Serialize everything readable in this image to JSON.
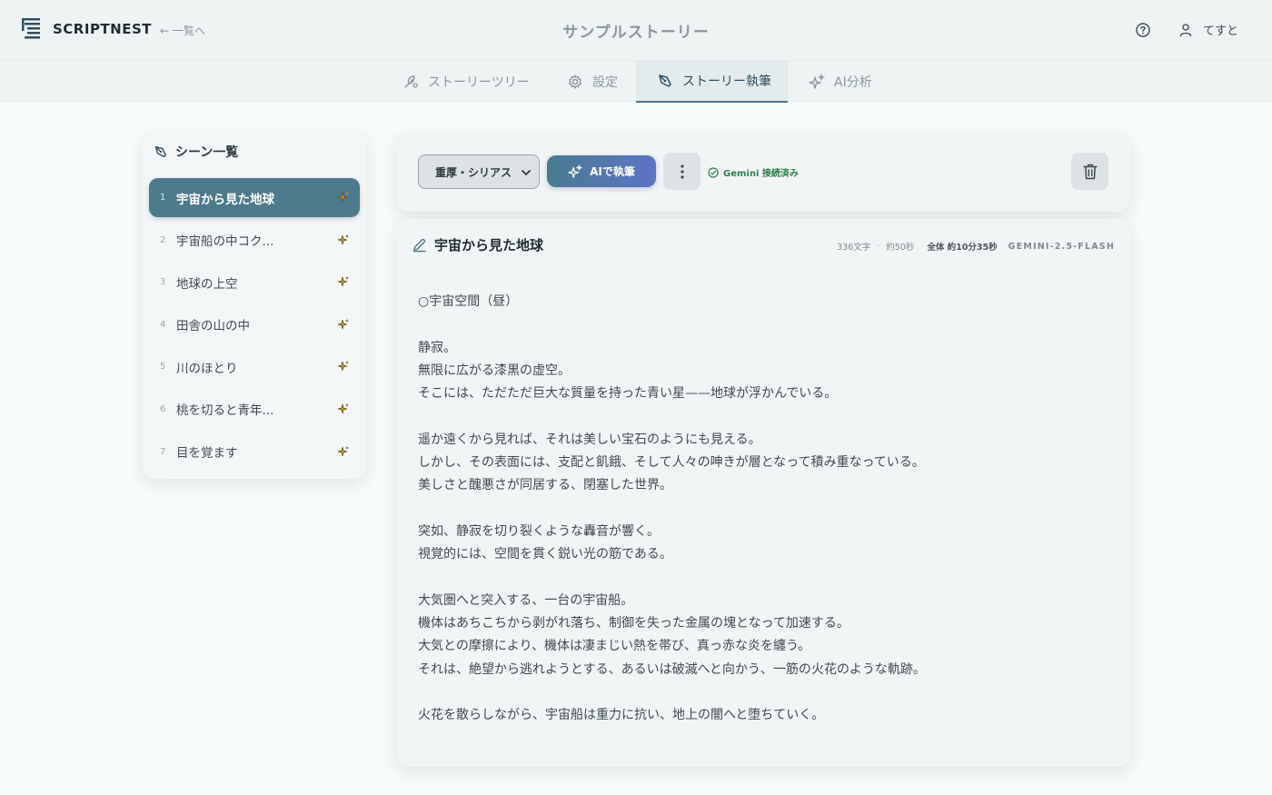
{
  "header": {
    "app_name": "SCRIPTNEST",
    "back_label": "← 一覧へ",
    "page_title": "サンプルストーリー",
    "user_name": "てすと"
  },
  "tabs": [
    {
      "label": "ストーリーツリー",
      "icon": "tree-icon"
    },
    {
      "label": "設定",
      "icon": "gear-icon"
    },
    {
      "label": "ストーリー執筆",
      "icon": "pen-nib-icon",
      "active": true
    },
    {
      "label": "AI分析",
      "icon": "sparkles-icon"
    }
  ],
  "sidebar": {
    "title": "シーン一覧",
    "scenes": [
      {
        "num": "1",
        "title": "宇宙から見た地球",
        "active": true
      },
      {
        "num": "2",
        "title": "宇宙船の中コク..."
      },
      {
        "num": "3",
        "title": "地球の上空"
      },
      {
        "num": "4",
        "title": "田舎の山の中"
      },
      {
        "num": "5",
        "title": "川のほとり"
      },
      {
        "num": "6",
        "title": "桃を切ると青年..."
      },
      {
        "num": "7",
        "title": "目を覚ます"
      }
    ]
  },
  "toolbar": {
    "tone_selected": "重厚・シリアス",
    "ai_write_label": "AIで執筆",
    "status_label": "Gemini 接続済み"
  },
  "editor": {
    "scene_title": "宇宙から見た地球",
    "char_count": "336文字",
    "duration": "約50秒",
    "total_duration": "全体 約10分35秒",
    "model": "GEMINI-2.5-FLASH",
    "body": "○宇宙空間（昼）\n\n静寂。\n無限に広がる漆黒の虚空。\nそこには、ただただ巨大な質量を持った青い星——地球が浮かんでいる。\n\n遥か遠くから見れば、それは美しい宝石のようにも見える。\nしかし、その表面には、支配と飢餓、そして人々の呻きが層となって積み重なっている。\n美しさと醜悪さが同居する、閉塞した世界。\n\n突如、静寂を切り裂くような轟音が響く。\n視覚的には、空間を貫く鋭い光の筋である。\n\n大気圏へと突入する、一台の宇宙船。\n機体はあちこちから剥がれ落ち、制御を失った金属の塊となって加速する。\n大気との摩擦により、機体は凄まじい熱を帯び、真っ赤な炎を纏う。\nそれは、絶望から逃れようとする、あるいは破滅へと向かう、一筋の火花のような軌跡。\n\n火花を散らしながら、宇宙船は重力に抗い、地上の闇へと堕ちていく。"
  },
  "colors": {
    "accent": "#4d7a8c",
    "ai_gradient_end": "#5c74c4",
    "status_green": "#2e7d4a",
    "ai_mark": "#8a6a1e"
  }
}
